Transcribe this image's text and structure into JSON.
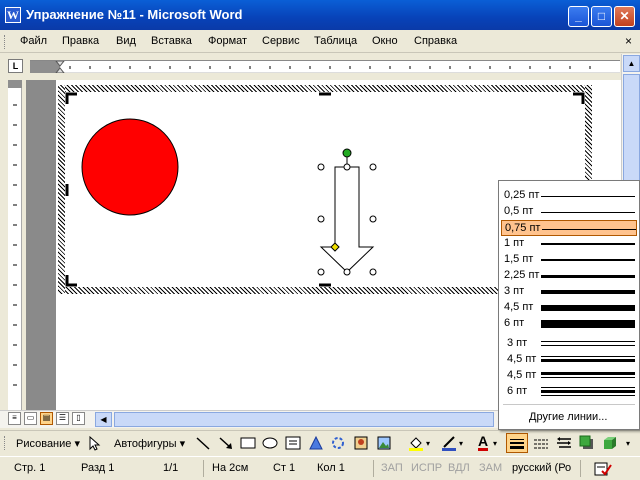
{
  "window": {
    "app_icon": "W",
    "title": "Упражнение №11 - Microsoft Word",
    "buttons": {
      "minimize": "_",
      "maximize": "□",
      "close": "✕"
    }
  },
  "menubar": {
    "items": [
      "Файл",
      "Правка",
      "Вид",
      "Вставка",
      "Формат",
      "Сервис",
      "Таблица",
      "Окно",
      "Справка"
    ],
    "close_doc": "×"
  },
  "ruler": {
    "tab_button": "L"
  },
  "canvas": {
    "circle_color": "#ff0000",
    "arrow_icon": "down-arrow-shape",
    "rotation_handle_color": "#22aa22",
    "adjust_handle_color": "#f0e000"
  },
  "line_weights": {
    "items": [
      {
        "label": "0,25 пт",
        "style": "single",
        "selected": false
      },
      {
        "label": "0,5 пт",
        "style": "single",
        "selected": false
      },
      {
        "label": "0,75 пт",
        "style": "single",
        "selected": true
      },
      {
        "label": "1 пт",
        "style": "single",
        "selected": false
      },
      {
        "label": "1,5 пт",
        "style": "single",
        "selected": false
      },
      {
        "label": "2,25 пт",
        "style": "single",
        "selected": false
      },
      {
        "label": "3 пт",
        "style": "single",
        "selected": false
      },
      {
        "label": "4,5 пт",
        "style": "single",
        "selected": false
      },
      {
        "label": "6 пт",
        "style": "single",
        "selected": false
      },
      {
        "label": "3 пт",
        "style": "double",
        "selected": false
      },
      {
        "label": "4,5 пт",
        "style": "thin-thick",
        "selected": false
      },
      {
        "label": "4,5 пт",
        "style": "thick-thin",
        "selected": false
      },
      {
        "label": "6 пт",
        "style": "triple",
        "selected": false
      }
    ],
    "more": "Другие линии...",
    "selected_color": "#ffc38e"
  },
  "drawbar": {
    "draw_label": "Рисование",
    "autoshapes_label": "Автофигуры",
    "font_color_letter": "A"
  },
  "status": {
    "page": "Стр. 1",
    "section": "Разд 1",
    "pages": "1/1",
    "at": "На 2см",
    "line": "Ст 1",
    "col": "Кол 1",
    "rec": "ЗАП",
    "trk": "ИСПР",
    "ext": "ВДЛ",
    "ovr": "ЗАМ",
    "lang": "русский (Ро"
  }
}
